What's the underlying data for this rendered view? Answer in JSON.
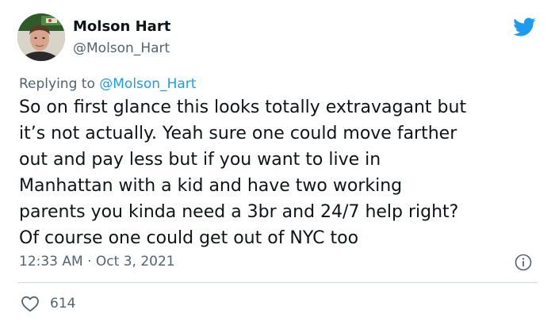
{
  "author": {
    "name": "Molson Hart",
    "handle": "@Molson_Hart"
  },
  "reply": {
    "prefix": "Replying to ",
    "to": "@Molson_Hart"
  },
  "tweet": {
    "text": "So on first glance this looks totally extravagant but\nit’s not actually. Yeah sure one could move farther\nout and pay less but if you want to live in\nManhattan with a kid and have two working\nparents you kinda need a 3br and 24/7 help right?\nOf course one could get out of NYC too",
    "timestamp": "12:33 AM · Oct 3, 2021",
    "likes": "614"
  },
  "icons": {
    "brand": "twitter-bird-icon",
    "info": "info-icon",
    "like": "heart-icon"
  },
  "colors": {
    "text": "#0f1419",
    "secondary": "#536471",
    "link": "#1d9bf0",
    "divider": "#cfd9de"
  }
}
